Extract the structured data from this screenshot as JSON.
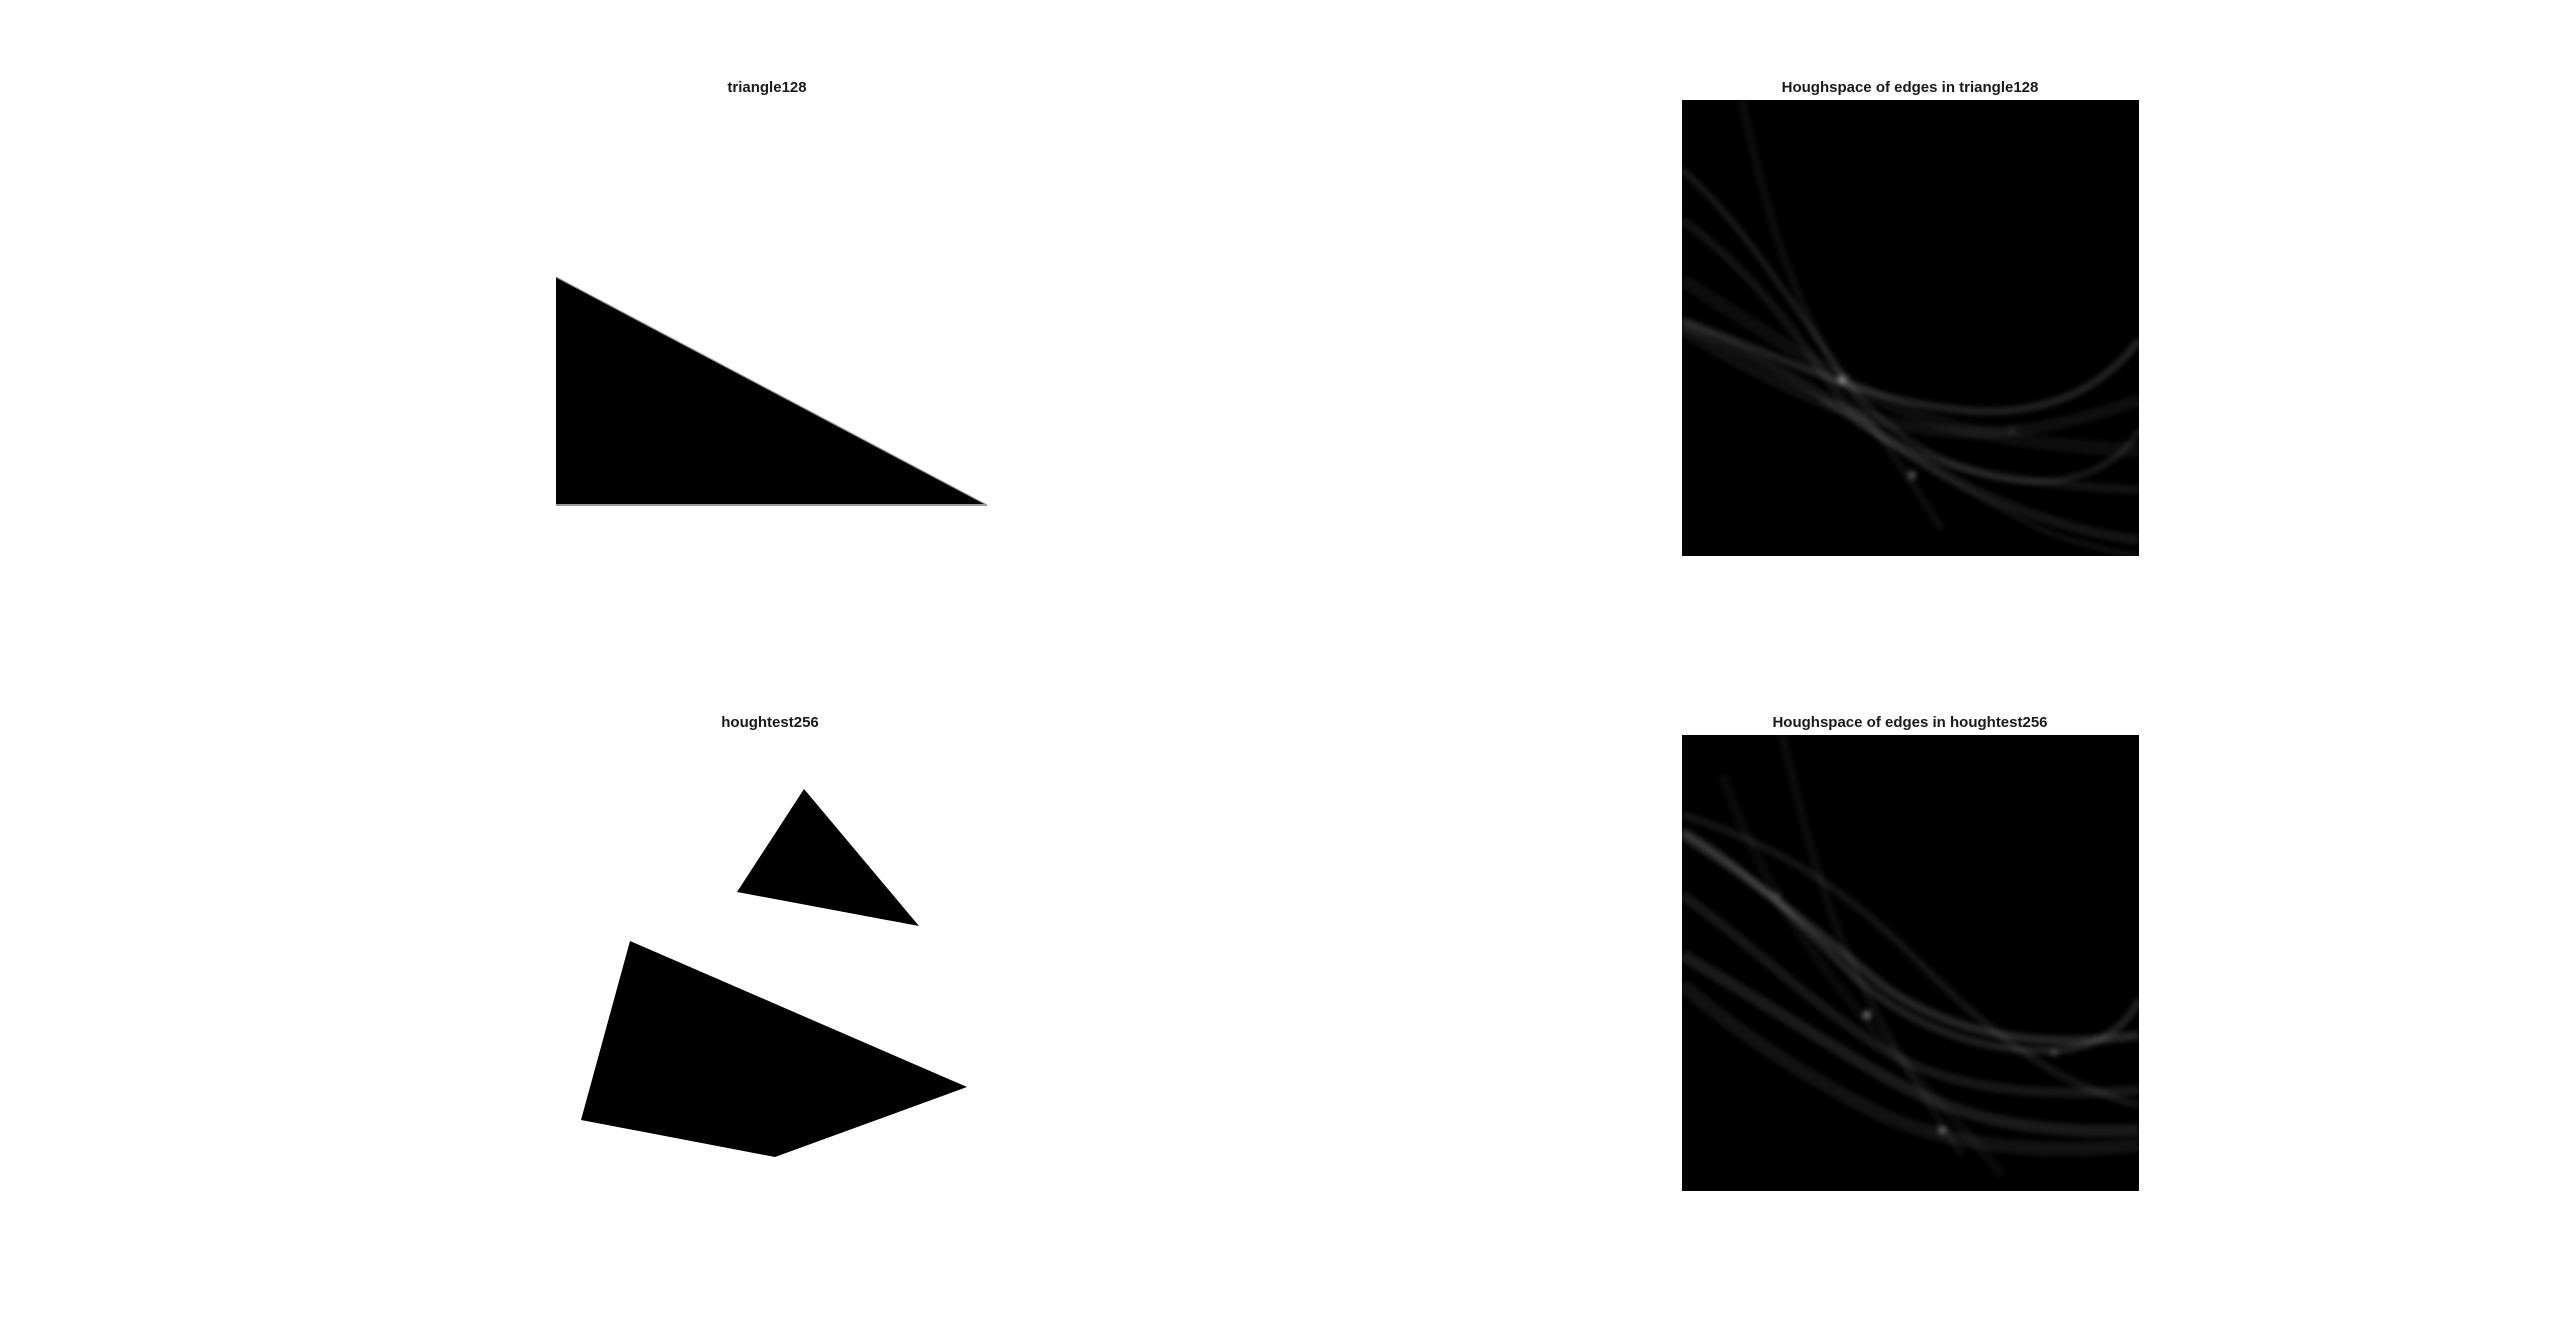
{
  "figure": {
    "panels": [
      {
        "title": "triangle128"
      },
      {
        "title": "Houghspace of edges in triangle128"
      },
      {
        "title": "houghtest256"
      },
      {
        "title": "Houghspace of edges in houghtest256"
      }
    ]
  },
  "colors": {
    "background": "#ffffff",
    "shape": "#000000",
    "hough_background": "#000000",
    "hough_curve": "#ffffff"
  }
}
